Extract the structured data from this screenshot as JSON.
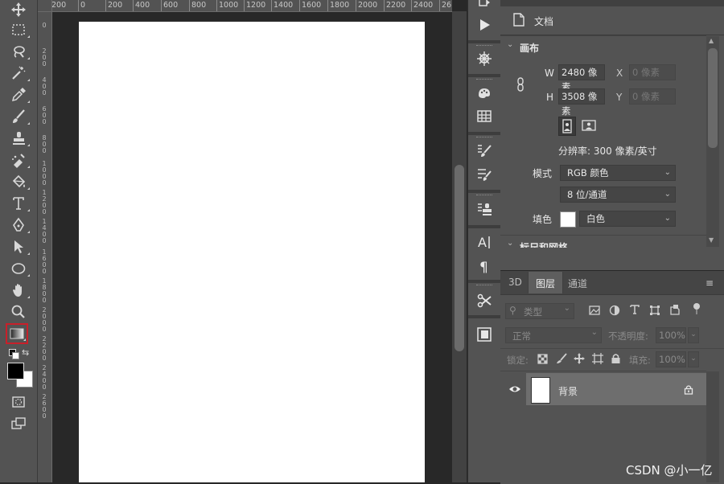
{
  "hruler": {
    "labels": [
      "200",
      "0",
      "200",
      "400",
      "600",
      "800",
      "1000",
      "1200",
      "1400",
      "1600",
      "1800",
      "2000",
      "2200",
      "2400",
      "26"
    ]
  },
  "vruler": {
    "labels": [
      "0",
      "200",
      "400",
      "600",
      "800",
      "1000",
      "1200",
      "1400",
      "1600",
      "1800",
      "2000",
      "2200",
      "2400",
      "2600"
    ]
  },
  "toolbar": {
    "tools": [
      {
        "name": "move-tool-icon"
      },
      {
        "name": "marquee-tool-icon"
      },
      {
        "name": "lasso-tool-icon"
      },
      {
        "name": "magic-wand-tool-icon"
      },
      {
        "name": "eyedropper-tool-icon"
      },
      {
        "name": "brush-tool-icon"
      },
      {
        "name": "clone-stamp-tool-icon"
      },
      {
        "name": "healing-brush-tool-icon"
      },
      {
        "name": "eraser-tool-icon"
      },
      {
        "name": "type-tool-icon"
      },
      {
        "name": "pen-tool-icon"
      },
      {
        "name": "path-selection-tool-icon"
      },
      {
        "name": "ellipse-tool-icon"
      },
      {
        "name": "hand-tool-icon"
      },
      {
        "name": "zoom-tool-icon"
      },
      {
        "name": "gradient-tool-icon",
        "active": true
      }
    ],
    "foreground_color": "#000000",
    "background_color": "#ffffff",
    "accent_highlight": "#c8202a"
  },
  "properties": {
    "tab_label": "文档",
    "section_canvas": "画布",
    "w_label": "W",
    "w_value": "2480 像素",
    "x_label": "X",
    "x_placeholder": "0 像素",
    "h_label": "H",
    "h_value": "3508 像素",
    "y_label": "Y",
    "y_placeholder": "0 像素",
    "resolution": "分辨率: 300 像素/英寸",
    "mode_label": "模式",
    "mode_value": "RGB 颜色",
    "bitdepth_value": "8 位/通道",
    "fill_label": "填色",
    "fill_value": "白色",
    "fill_swatch": "#ffffff",
    "section_rulers": "标尺和网格"
  },
  "layers_panel": {
    "tabs": [
      "3D",
      "图层",
      "通道"
    ],
    "active_tab": "图层",
    "filter_kind": "类型",
    "blend_mode": "正常",
    "opacity_label": "不透明度:",
    "opacity_value": "100%",
    "lock_label": "锁定:",
    "fill_label": "填充:",
    "fill_value": "100%",
    "layers": [
      {
        "name": "背景",
        "visible": true,
        "locked": true
      }
    ]
  },
  "watermark": "CSDN @小一亿"
}
